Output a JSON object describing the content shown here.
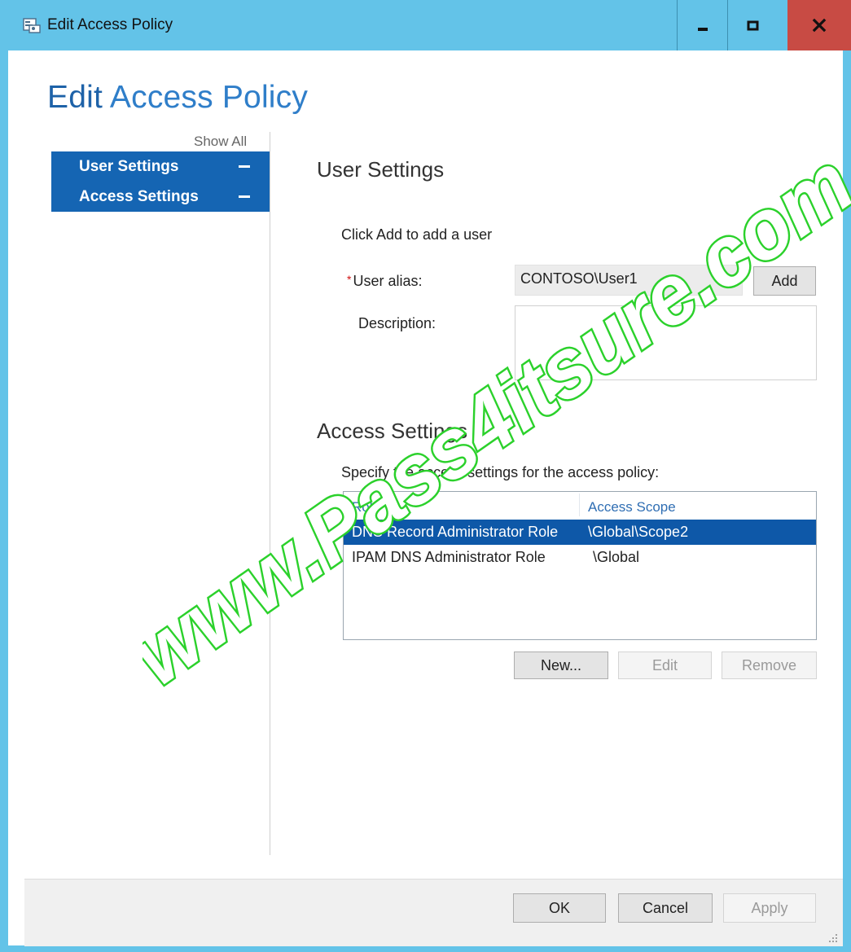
{
  "window": {
    "title": "Edit Access Policy",
    "controls": {
      "minimize": "minimize",
      "maximize": "maximize",
      "close": "close"
    }
  },
  "page": {
    "title_part1": "Edit",
    "title_part2": "Access Policy"
  },
  "nav": {
    "show_all": "Show All",
    "items": [
      {
        "label": "User Settings"
      },
      {
        "label": "Access Settings"
      }
    ]
  },
  "user_settings": {
    "heading": "User Settings",
    "instruction": "Click Add to add a user",
    "required_marker": "*",
    "alias_label": "User alias:",
    "alias_value": "CONTOSO\\User1",
    "add_button": "Add",
    "description_label": "Description:",
    "description_value": ""
  },
  "access_settings": {
    "heading": "Access Settings",
    "instruction": "Specify the access settings for the access policy:",
    "columns": [
      "Role",
      "Access Scope"
    ],
    "rows": [
      {
        "role": "DNS Record Administrator Role",
        "scope": "\\Global\\Scope2",
        "selected": true
      },
      {
        "role": "IPAM DNS Administrator Role",
        "scope": "\\Global",
        "selected": false
      }
    ],
    "new_button": "New...",
    "edit_button": "Edit",
    "remove_button": "Remove"
  },
  "footer": {
    "ok": "OK",
    "cancel": "Cancel",
    "apply": "Apply"
  },
  "watermark": "www.Pass4itsure.com",
  "colors": {
    "titlebar": "#63c3e8",
    "nav_selected": "#1565b3",
    "row_selected": "#0e58a8",
    "close_button": "#c84b44",
    "title_text": "#1e62a8",
    "watermark": "#2bd12b"
  }
}
